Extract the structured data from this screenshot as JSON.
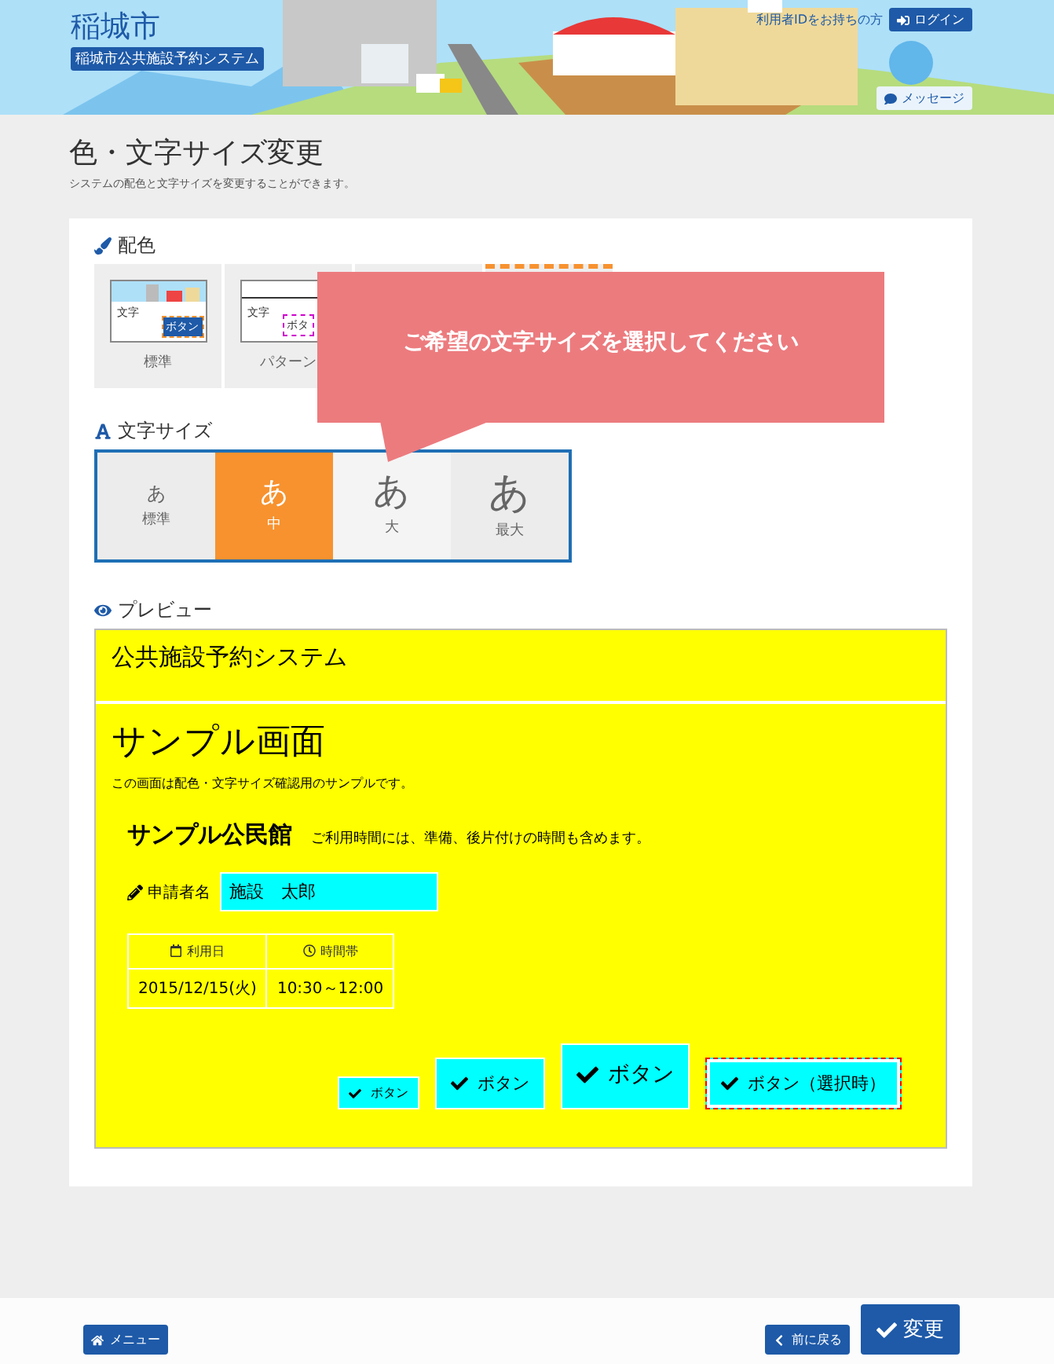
{
  "header": {
    "city": "稲城市",
    "system": "稲城市公共施設予約システム",
    "login_prompt": "利用者IDをお持ちの方",
    "login_button": "ログイン",
    "message_button": "メッセージ"
  },
  "page": {
    "title": "色・文字サイズ変更",
    "subtitle": "システムの配色と文字サイズを変更することができます。"
  },
  "color_scheme": {
    "label": "配色",
    "options": [
      {
        "kind": "picture",
        "label": "標準",
        "preview_text": "文字",
        "preview_button": "ボタン",
        "selected": false
      },
      {
        "kind": "plain",
        "label": "パターン",
        "preview_text": "文字",
        "preview_button": "ボタ",
        "selected": false
      },
      {
        "kind": "hidden",
        "selected": false
      },
      {
        "kind": "hidden",
        "selected": true
      }
    ]
  },
  "font_size": {
    "label": "文字サイズ",
    "options": [
      {
        "kind": "small",
        "glyph": "あ",
        "label": "標準",
        "selected": false
      },
      {
        "kind": "medium",
        "glyph": "あ",
        "label": "中",
        "selected": true
      },
      {
        "kind": "large",
        "glyph": "あ",
        "label": "大",
        "selected": false
      },
      {
        "kind": "largest",
        "glyph": "あ",
        "label": "最大",
        "selected": false
      }
    ]
  },
  "tooltip": "ご希望の文字サイズを選択してください",
  "preview": {
    "label": "プレビュー",
    "system_title": "公共施設予約システム",
    "heading": "サンプル画面",
    "description": "この画面は配色・文字サイズ確認用のサンプルです。",
    "facility": "サンプル公民館",
    "facility_note": "ご利用時間には、準備、後片付けの時間も含めます。",
    "applicant_label": "申請者名",
    "applicant_value": "施設　太郎",
    "table": {
      "columns": [
        "利用日",
        "時間帯"
      ],
      "rows": [
        [
          "2015/12/15(火)",
          "10:30～12:00"
        ]
      ]
    },
    "buttons": [
      {
        "kind": "small",
        "label": "ボタン",
        "selected": false
      },
      {
        "kind": "medium",
        "label": "ボタン",
        "selected": false
      },
      {
        "kind": "large",
        "label": "ボタン",
        "selected": false
      },
      {
        "kind": "medium",
        "label": "ボタン（選択時）",
        "selected": true
      }
    ]
  },
  "footer": {
    "menu_button": "メニュー",
    "back_button": "前に戻る",
    "submit_button": "変更"
  }
}
